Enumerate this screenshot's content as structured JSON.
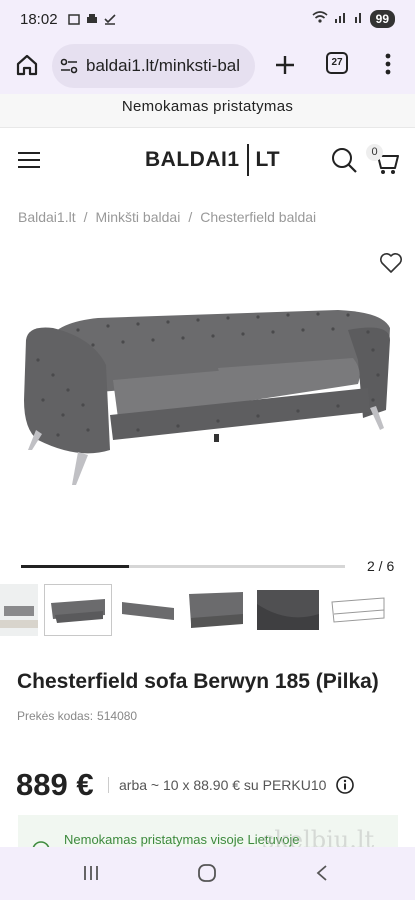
{
  "status_bar": {
    "time": "18:02",
    "battery": "99"
  },
  "browser": {
    "url": "baldai1.lt/minksti-bal",
    "tab_count": "27"
  },
  "promo_banner": "Nemokamas pristatymas",
  "header": {
    "logo_left": "BALDAI1",
    "logo_right": "LT",
    "cart_count": "0"
  },
  "breadcrumb": {
    "items": [
      "Baldai1.lt",
      "Minkšti baldai",
      "Chesterfield baldai"
    ],
    "separator": "/"
  },
  "gallery": {
    "counter": "2 / 6",
    "progress_fraction": 0.333,
    "thumbnails": [
      "sofa-living-room",
      "sofa-front",
      "sofa-side",
      "sofa-angle",
      "sofa-detail",
      "sofa-drawing"
    ],
    "selected_index": 1
  },
  "product": {
    "title": "Chesterfield sofa Berwyn 185 (Pilka)",
    "sku_label": "Prekės kodas:",
    "sku_value": "514080",
    "price": "889 €",
    "installment_text": "arba ~ 10 x 88.90 € su PERKU10",
    "color": "#6b6b6d"
  },
  "delivery": {
    "text": "Nemokamas pristatymas visoje Lietuvoje"
  },
  "watermark": "skelbiu.lt"
}
